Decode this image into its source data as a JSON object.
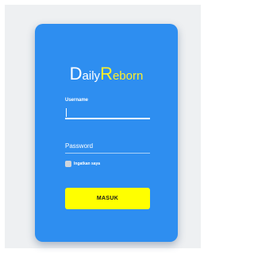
{
  "brand": {
    "first_initial": "D",
    "first_rest": "aily",
    "second_initial": "R",
    "second_rest": "eborn"
  },
  "form": {
    "username_label": "Username",
    "username_value": "",
    "password_placeholder": "Password",
    "remember_label": "Ingatkan saya",
    "remember_checked": false,
    "submit_label": "MASUK"
  },
  "colors": {
    "card": "#2e8ef0",
    "accent_yellow": "#ffef2a",
    "button": "#ffff00",
    "background": "#eef0f2"
  }
}
